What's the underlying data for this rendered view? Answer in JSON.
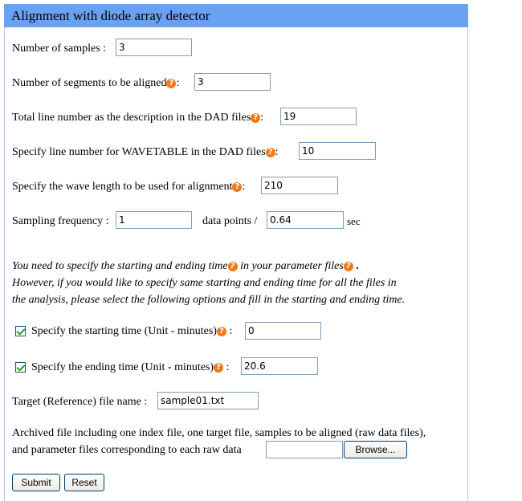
{
  "title": "Alignment with diode array detector",
  "fields": {
    "num_samples": {
      "label": "Number of samples :",
      "value": "3"
    },
    "num_segments": {
      "label": "Number of segments to be aligned",
      "value": "3"
    },
    "total_line": {
      "label": "Total line number as the description in the DAD files",
      "value": "19"
    },
    "wavetable_line": {
      "label": "Specify line number for WAVETABLE in the DAD files",
      "value": "10"
    },
    "wave_length": {
      "label": "Specify the wave length to be used for alignment",
      "value": "210"
    },
    "sampling": {
      "label": "Sampling frequency :",
      "value": "1",
      "mid_text": "data points /",
      "value2": "0.64",
      "unit": "sec"
    }
  },
  "note": {
    "line1a": "You need to specify the starting and ending time",
    "line1b": " in your parameter files",
    "line1c": " .",
    "line2": "However, if you would like to specify same starting and ending time for all the files in",
    "line3": "the analysis, please select the following options and fill in the starting and ending time."
  },
  "start_time": {
    "label": "Specify the starting time (Unit - minutes)",
    "value": "0",
    "checked": true
  },
  "end_time": {
    "label": "Specify the ending time (Unit - minutes)",
    "value": "20.6",
    "checked": true
  },
  "target": {
    "label": "Target (Reference) file name :",
    "value": "sample01.txt"
  },
  "archive": {
    "line1": "Archived file including one index file, one target file, samples to be aligned (raw data files),",
    "line2": "and parameter files corresponding to each raw data",
    "browse": "Browse..."
  },
  "buttons": {
    "submit": "Submit",
    "reset": "Reset"
  },
  "help_glyph": "?",
  "colon": ":"
}
